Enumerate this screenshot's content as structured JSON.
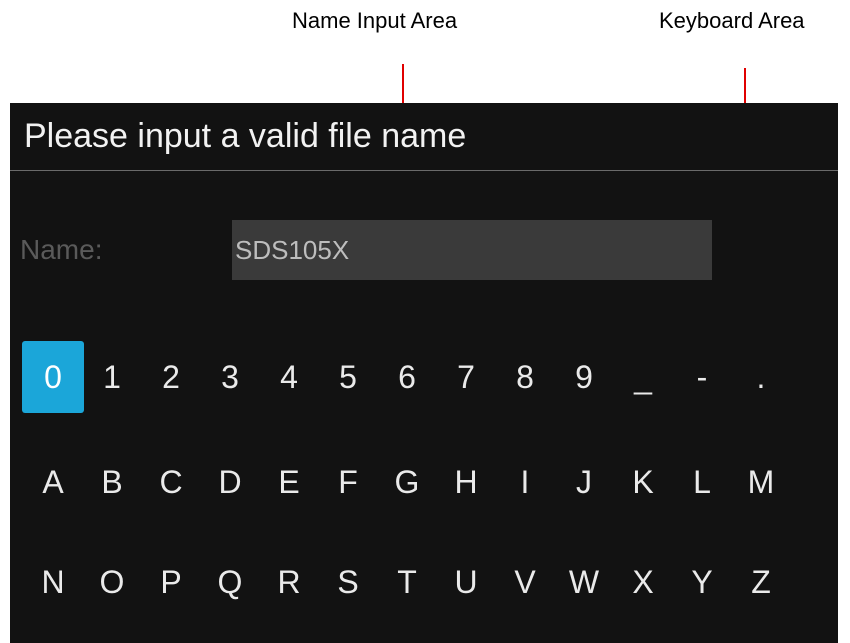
{
  "callouts": {
    "name_input": "Name Input Area",
    "keyboard": "Keyboard Area"
  },
  "colors": {
    "arrow": "#e00000",
    "dialog_background": "#121212",
    "input_background": "#3a3a3a",
    "selected_key": "#1ba6d9"
  },
  "dialog": {
    "title": "Please input a valid file name",
    "name_label": "Name:",
    "name_value": "SDS105X"
  },
  "keyboard": {
    "selected_key": "0",
    "rows": [
      [
        "0",
        "1",
        "2",
        "3",
        "4",
        "5",
        "6",
        "7",
        "8",
        "9",
        "_",
        "-",
        "."
      ],
      [
        "A",
        "B",
        "C",
        "D",
        "E",
        "F",
        "G",
        "H",
        "I",
        "J",
        "K",
        "L",
        "M"
      ],
      [
        "N",
        "O",
        "P",
        "Q",
        "R",
        "S",
        "T",
        "U",
        "V",
        "W",
        "X",
        "Y",
        "Z"
      ]
    ]
  }
}
